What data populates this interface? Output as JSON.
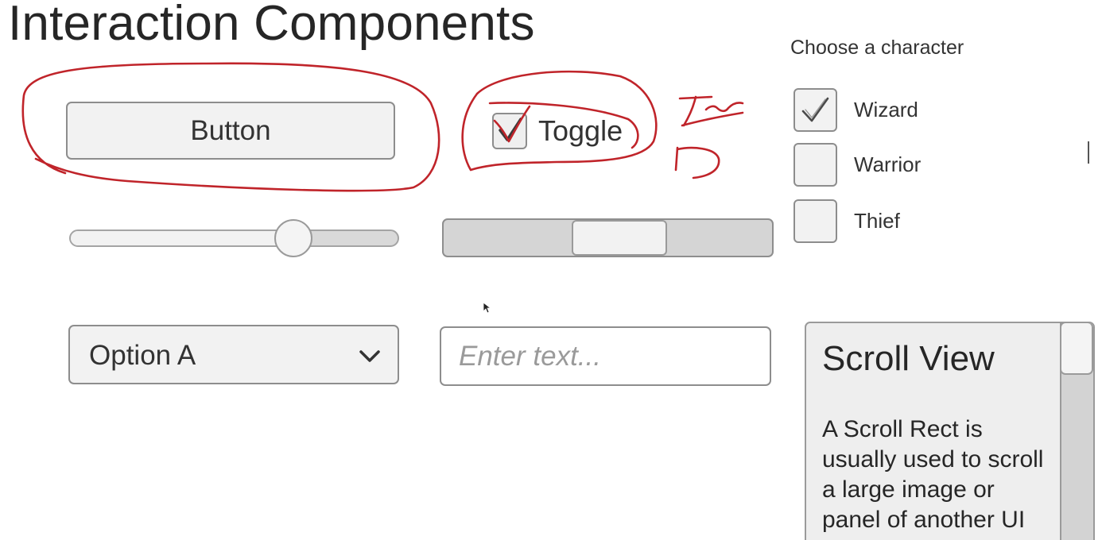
{
  "header": {
    "title": "Interaction Components"
  },
  "controls": {
    "button_label": "Button",
    "toggle": {
      "label": "Toggle",
      "checked": true
    },
    "slider": {
      "value": 0.68
    },
    "scrollbar": {
      "value": 0.55,
      "size": 0.29
    },
    "dropdown": {
      "selected": "Option A"
    },
    "input": {
      "placeholder": "Enter text...",
      "value": ""
    }
  },
  "character_group": {
    "title": "Choose a character",
    "options": [
      {
        "label": "Wizard",
        "checked": true
      },
      {
        "label": "Warrior",
        "checked": false
      },
      {
        "label": "Thief",
        "checked": false
      }
    ]
  },
  "scroll_view": {
    "title": "Scroll View",
    "body": "A Scroll Rect is usually used to scroll a large image or panel of another UI"
  },
  "annotations": {
    "text": "True",
    "color": "#c0242a"
  },
  "icons": {
    "toggle_check": "checkmark-icon",
    "wizard_check": "checkmark-icon",
    "dropdown_arrow": "chevron-down-icon",
    "cursor": "mouse-pointer-icon"
  },
  "colors": {
    "control_bg": "#f2f2f2",
    "border": "#8d8d8d",
    "track_bg": "#d5d5d5",
    "annotation": "#c0242a"
  }
}
